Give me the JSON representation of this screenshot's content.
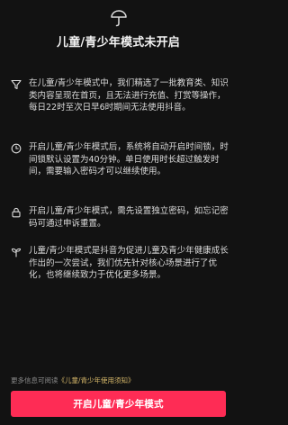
{
  "header": {
    "title": "儿童/青少年模式未开启",
    "icon": "umbrella-icon"
  },
  "items": [
    {
      "icon": "filter-icon",
      "text": "在儿童/青少年模式中，我们精选了一批教育类、知识类内容呈现在首页，且无法进行充值、打赏等操作，每日22时至次日早6时期间无法使用抖音。"
    },
    {
      "icon": "clock-icon",
      "text": "开启儿童/青少年模式后，系统将自动开启时间锁，时间锁默认设置为40分钟。单日使用时长超过触发时间，需要输入密码才可以继续使用。"
    },
    {
      "icon": "lock-icon",
      "text": "开启儿童/青少年模式，需先设置独立密码，如忘记密码可通过申诉重置。"
    },
    {
      "icon": "sprout-icon",
      "text": "儿童/青少年模式是抖音为促进儿童及青少年健康成长作出的一次尝试，我们优先针对核心场景进行了优化，也将继续致力于优化更多场景。"
    }
  ],
  "footer": {
    "note_prefix": "更多信息可阅读",
    "note_link": "《儿童/青少年使用须知》",
    "cta_label": "开启儿童/青少年模式"
  },
  "colors": {
    "background": "#121212",
    "accent": "#fe2c55",
    "link": "#d7b86a"
  }
}
